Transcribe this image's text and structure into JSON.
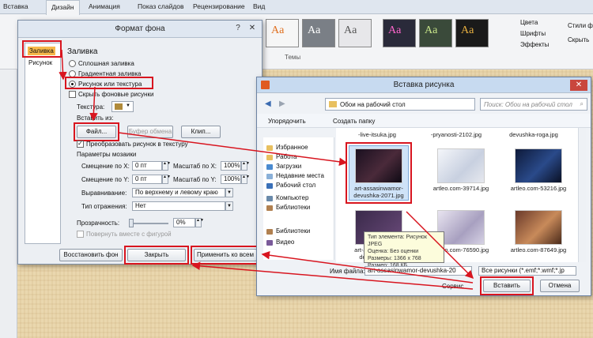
{
  "ribbon": {
    "tabs": [
      "Вставка",
      "Дизайн",
      "Анимация",
      "Показ слайдов",
      "Рецензирование",
      "Вид"
    ],
    "active_tab": "Дизайн",
    "theme_sample": "Aa",
    "themes_label": "Темы",
    "right_items": [
      "Цвета",
      "Шрифты",
      "Эффекты",
      "Стили ф",
      "Скрыть"
    ]
  },
  "format_dialog": {
    "title": "Формат фона",
    "side_items": [
      "Заливка",
      "Рисунок"
    ],
    "section_title": "Заливка",
    "fill_options": [
      "Сплошная заливка",
      "Градиентная заливка",
      "Рисунок или текстура"
    ],
    "hide_bg": "Скрыть фоновые рисунки",
    "texture_label": "Текстура:",
    "insert_from": "Вставить из:",
    "btn_file": "Файл...",
    "btn_clipboard": "Буфер обмена",
    "btn_clip": "Клип...",
    "tile_check": "Преобразовать рисунок в текстуру",
    "tile_params": "Параметры мозаики",
    "offset_x": "Смещение по X:",
    "offset_x_val": "0 пт",
    "scale_x": "Масштаб по X:",
    "scale_x_val": "100%",
    "offset_y": "Смещение по Y:",
    "offset_y_val": "0 пт",
    "scale_y": "Масштаб по Y:",
    "scale_y_val": "100%",
    "align": "Выравнивание:",
    "align_val": "По верхнему и левому краю",
    "mirror": "Тип отражения:",
    "mirror_val": "Нет",
    "transparency": "Прозрачность:",
    "transparency_val": "0%",
    "rotate_check": "Повернуть вместе с фигурой",
    "btn_reset": "Восстановить фон",
    "btn_close": "Закрыть",
    "btn_apply_all": "Применить ко всем"
  },
  "insert_dialog": {
    "title": "Вставка рисунка",
    "path": "Обои на рабочий стол",
    "search_placeholder": "Поиск: Обои на рабочий стол",
    "organize": "Упорядочить",
    "new_folder": "Создать папку",
    "nav": [
      "Избранное",
      "Работа",
      "Загрузки",
      "Недавние места",
      "Рабочий стол",
      "Компьютер",
      "Библиотеки",
      "Библиотеки",
      "Видео"
    ],
    "top_files": [
      "-live-itsuka.jpg",
      "-pryanosti-2102.jpg",
      "devushka-roga.jpg"
    ],
    "row1": [
      "art-assasinwamor-devushka-2071.jpg",
      "artleo.com-39714.jpg",
      "artleo.com-53216.jpg"
    ],
    "row2": [
      "art-assasinwamor-devushka-20...",
      "artleo.com-76590.jpg",
      "artleo.com-87649.jpg"
    ],
    "tooltip": [
      "Тип элемента: Рисунок JPEG",
      "Оценка: Без оценки",
      "Размеры: 1366 x 768",
      "Размер: 168 КБ"
    ],
    "filename_label": "Имя файла:",
    "filename_value": "art-assasinwamor-devushka-20",
    "filter_value": "Все рисунки (*.emf;*.wmf;*.jp",
    "service": "Сервис",
    "btn_insert": "Вставить",
    "btn_cancel": "Отмена"
  },
  "colors": {
    "accent": "#d8151f",
    "dialog": "#eceff3",
    "slide": "#ead7ae"
  }
}
